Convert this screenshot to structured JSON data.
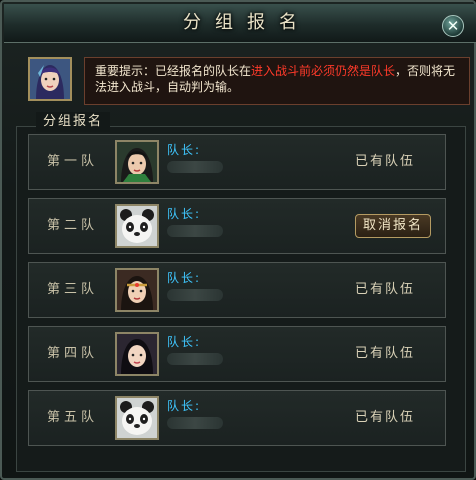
{
  "window": {
    "title": "分组报名",
    "close_glyph": "✕"
  },
  "notice": {
    "prefix": "重要提示：已经报名的队长在",
    "highlight": "进入战斗前必须仍然是队长",
    "suffix": "，否则将无法进入战斗，自动判为输。"
  },
  "group_section": {
    "title": "分组报名"
  },
  "teams": [
    {
      "name": "第一队",
      "captain_label": "队长:",
      "status": "已有队伍",
      "avatar": "female-warrior-green-icon"
    },
    {
      "name": "第二队",
      "captain_label": "队长:",
      "action": "取消报名",
      "avatar": "panda-icon"
    },
    {
      "name": "第三队",
      "captain_label": "队长:",
      "status": "已有队伍",
      "avatar": "female-warrior-headband-icon"
    },
    {
      "name": "第四队",
      "captain_label": "队长:",
      "status": "已有队伍",
      "avatar": "female-warrior-black-hair-icon"
    },
    {
      "name": "第五队",
      "captain_label": "队长:",
      "status": "已有队伍",
      "avatar": "panda-icon"
    }
  ],
  "colors": {
    "accent_blue": "#3fc7ff",
    "warning_red": "#ff3a2a",
    "gold_border": "#b49b62"
  }
}
